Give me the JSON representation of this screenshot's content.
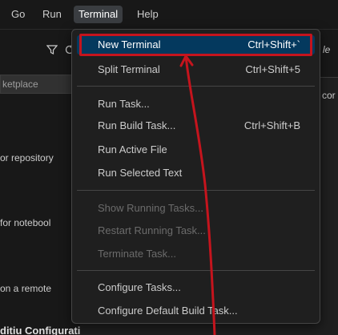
{
  "menubar": {
    "items": [
      "Go",
      "Run",
      "Terminal",
      "Help"
    ],
    "active": "Terminal"
  },
  "sidebar": {
    "search_placeholder": "ketplace",
    "texts": [
      "or repository",
      "for notebool",
      "on a remote"
    ],
    "heading": "ditiu Configuratio"
  },
  "editor": {
    "italic_text": "le",
    "side_text": "cor"
  },
  "dropdown": {
    "groups": [
      [
        {
          "label": "New Terminal",
          "shortcut": "Ctrl+Shift+`",
          "selected": true,
          "disabled": false
        },
        {
          "label": "Split Terminal",
          "shortcut": "Ctrl+Shift+5",
          "selected": false,
          "disabled": false
        }
      ],
      [
        {
          "label": "Run Task...",
          "shortcut": "",
          "selected": false,
          "disabled": false
        },
        {
          "label": "Run Build Task...",
          "shortcut": "Ctrl+Shift+B",
          "selected": false,
          "disabled": false
        },
        {
          "label": "Run Active File",
          "shortcut": "",
          "selected": false,
          "disabled": false
        },
        {
          "label": "Run Selected Text",
          "shortcut": "",
          "selected": false,
          "disabled": false
        }
      ],
      [
        {
          "label": "Show Running Tasks...",
          "shortcut": "",
          "selected": false,
          "disabled": true
        },
        {
          "label": "Restart Running Task...",
          "shortcut": "",
          "selected": false,
          "disabled": true
        },
        {
          "label": "Terminate Task...",
          "shortcut": "",
          "selected": false,
          "disabled": true
        }
      ],
      [
        {
          "label": "Configure Tasks...",
          "shortcut": "",
          "selected": false,
          "disabled": false
        },
        {
          "label": "Configure Default Build Task...",
          "shortcut": "",
          "selected": false,
          "disabled": false
        }
      ]
    ]
  },
  "icons": {
    "filter": "filter-icon",
    "refresh": "refresh-icon"
  },
  "colors": {
    "highlight": "#c5141d",
    "selection": "#04395e",
    "menu_bg": "#1f1f1f"
  }
}
